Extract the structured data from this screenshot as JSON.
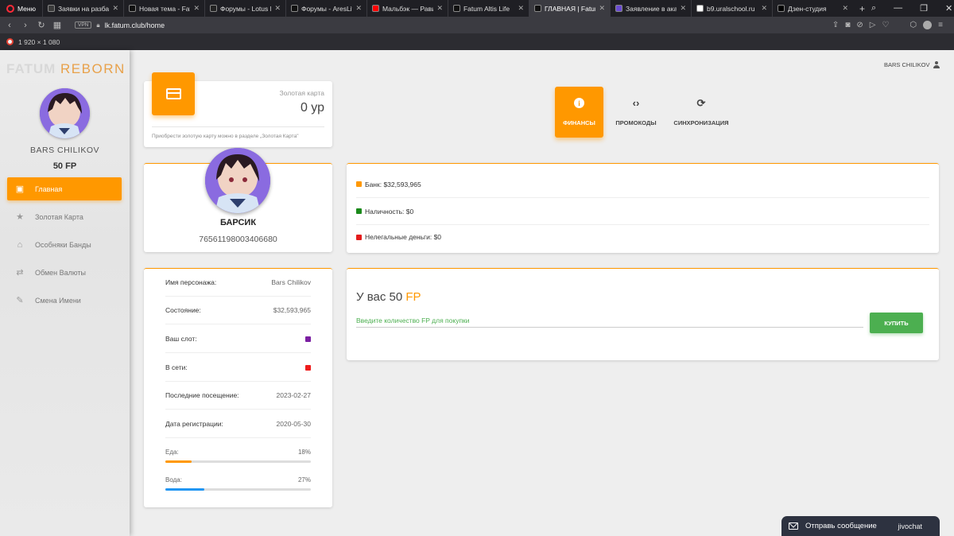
{
  "browser": {
    "menu_label": "Меню",
    "tabs": [
      {
        "title": "Заявки на разбан -",
        "color": "#3a3a3a",
        "active": false
      },
      {
        "title": "Новая тема - Fatum",
        "color": "#111111",
        "active": false
      },
      {
        "title": "Форумы - Lotus R",
        "color": "#222222",
        "active": false
      },
      {
        "title": "Форумы - AresLife.R",
        "color": "#111111",
        "active": false
      },
      {
        "title": "Мальбэк — Рави",
        "color": "#ff0000",
        "active": false
      },
      {
        "title": "Fatum Altis Life",
        "color": "#111111",
        "active": false
      },
      {
        "title": "ГЛАВНАЯ | Fatum",
        "color": "#111111",
        "active": true
      },
      {
        "title": "Заявление в академ",
        "color": "#6a4bd1",
        "active": false
      },
      {
        "title": "b9.uralschool.ru",
        "color": "#ffffff",
        "active": false
      },
      {
        "title": "Дзен-студия",
        "color": "#000000",
        "active": false
      }
    ],
    "vpn_label": "VPN",
    "url": "lk.fatum.club/home",
    "resolution": "1 920 × 1 080"
  },
  "sidebar": {
    "logo_a": "FATUM",
    "logo_b": "REBORN",
    "user_name": "BARS CHILIKOV",
    "fp": "50 FP",
    "items": [
      {
        "label": "Главная",
        "icon": "contact-card-icon",
        "glyph": "▣",
        "active": true
      },
      {
        "label": "Золотая Карта",
        "icon": "star-icon",
        "glyph": "★",
        "active": false
      },
      {
        "label": "Особняки Банды",
        "icon": "home-icon",
        "glyph": "⌂",
        "active": false
      },
      {
        "label": "Обмен Валюты",
        "icon": "swap-icon",
        "glyph": "⇄",
        "active": false
      },
      {
        "label": "Смена Имени",
        "icon": "pencil-icon",
        "glyph": "✎",
        "active": false
      }
    ]
  },
  "header": {
    "user_name": "BARS CHILIKOV"
  },
  "gold_card": {
    "label": "Золотая карта",
    "value": "0 ур",
    "note": "Приобрести золотую карту можно в разделе „Золотая Карта\""
  },
  "tabs": [
    {
      "label": "ФИНАНСЫ",
      "icon": "info-icon",
      "active": true
    },
    {
      "label": "ПРОМОКОДЫ",
      "icon": "code-icon",
      "active": false
    },
    {
      "label": "СИНХРОНИЗАЦИЯ",
      "icon": "sync-icon",
      "active": false
    }
  ],
  "profile": {
    "name": "БАРСИК",
    "steam_id": "76561198003406680"
  },
  "money": [
    {
      "label": "Банк: $32,593,965",
      "color": "#ff9800"
    },
    {
      "label": "Наличность: $0",
      "color": "#1b8a1b"
    },
    {
      "label": "Нелегальные деньги: $0",
      "color": "#e41b1b"
    }
  ],
  "stats": {
    "rows": [
      {
        "label": "Имя персонажа:",
        "value": "Bars Chilikov"
      },
      {
        "label": "Состояние:",
        "value": "$32,593,965"
      },
      {
        "label": "Ваш слот:",
        "value": "",
        "color": "#7b1fa2"
      },
      {
        "label": "В сети:",
        "value": "",
        "color": "#ee1c1c"
      },
      {
        "label": "Последние посещение:",
        "value": "2023-02-27"
      },
      {
        "label": "Дата регистрации:",
        "value": "2020-05-30"
      }
    ],
    "food_label": "Еда:",
    "food_value": "18%",
    "food_fraction": 0.18,
    "food_color": "#ff9800",
    "water_label": "Вода:",
    "water_value": "27%",
    "water_fraction": 0.27,
    "water_color": "#2196f3"
  },
  "buy": {
    "title_a": "У вас 50",
    "title_b": "FP",
    "placeholder": "Введите количество FP для покупки",
    "button": "КУПИТЬ"
  },
  "chat": {
    "label": "Отправь сообщение",
    "brand": "jivochat"
  }
}
